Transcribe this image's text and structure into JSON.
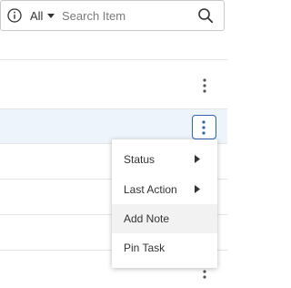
{
  "search": {
    "filter_value": "All",
    "placeholder": "Search Item",
    "value": ""
  },
  "icons": {
    "info": "info-circle-icon",
    "caret": "caret-down-icon",
    "search": "search-icon",
    "more": "more-vertical-icon",
    "submenu": "caret-right-icon"
  },
  "context_menu": {
    "items": [
      {
        "label": "Status",
        "has_submenu": true
      },
      {
        "label": "Last Action",
        "has_submenu": true
      },
      {
        "label": "Add Note",
        "has_submenu": false,
        "hovered": true
      },
      {
        "label": "Pin Task",
        "has_submenu": false
      }
    ]
  },
  "colors": {
    "accent": "#2c64b4",
    "selected_row": "#eef4fb",
    "menu_hover": "#f2f2f2",
    "divider": "#e4e4e4"
  }
}
